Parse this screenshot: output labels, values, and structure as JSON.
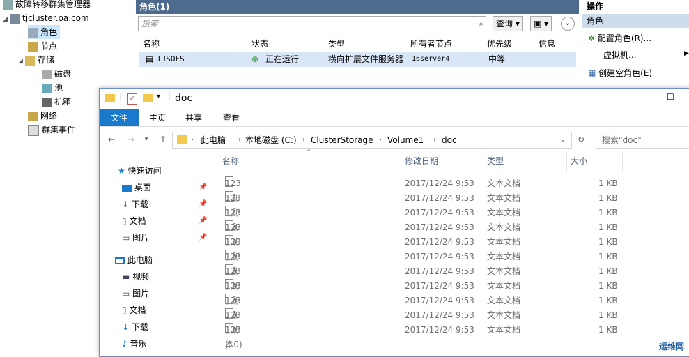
{
  "tree": {
    "app": "故障转移群集管理器",
    "cluster": "tjcluster.oa.com",
    "items": [
      "角色",
      "节点",
      "存储",
      "磁盘",
      "池",
      "机箱",
      "网络",
      "群集事件"
    ]
  },
  "center": {
    "title": "角色(1)",
    "search_placeholder": "搜索",
    "query_btn": "查询",
    "columns": [
      "名称",
      "状态",
      "类型",
      "所有者节点",
      "优先级",
      "信息"
    ],
    "row": {
      "name": "TJSOFS",
      "status": "正在运行",
      "type": "横向扩展文件服务器",
      "owner": "16server4",
      "priority": "中等",
      "info": ""
    }
  },
  "actions": {
    "title": "操作",
    "section": "角色",
    "items": [
      "配置角色(R)...",
      "虚拟机...",
      "创建空角色(E)"
    ]
  },
  "explorer": {
    "title": "doc",
    "tabs": [
      "文件",
      "主页",
      "共享",
      "查看"
    ],
    "path": [
      "此电脑",
      "本地磁盘 (C:)",
      "ClusterStorage",
      "Volume1",
      "doc"
    ],
    "search_placeholder": "搜索\"doc\"",
    "nav": {
      "quick": "快速访问",
      "quick_items": [
        "桌面",
        "下载",
        "文档",
        "图片"
      ],
      "pc": "此电脑",
      "pc_items": [
        "视频",
        "图片",
        "文档",
        "下载",
        "音乐"
      ]
    },
    "columns": [
      "名称",
      "修改日期",
      "类型",
      "大小"
    ],
    "files": [
      {
        "name": "123 - 副本 (2)",
        "date": "2017/12/24 9:53",
        "type": "文本文档",
        "size": "1 KB"
      },
      {
        "name": "123 - 副本 (3)",
        "date": "2017/12/24 9:53",
        "type": "文本文档",
        "size": "1 KB"
      },
      {
        "name": "123 - 副本 (4)",
        "date": "2017/12/24 9:53",
        "type": "文本文档",
        "size": "1 KB"
      },
      {
        "name": "123 - 副本 (5)",
        "date": "2017/12/24 9:53",
        "type": "文本文档",
        "size": "1 KB"
      },
      {
        "name": "123 - 副本 (6)",
        "date": "2017/12/24 9:53",
        "type": "文本文档",
        "size": "1 KB"
      },
      {
        "name": "123 - 副本 (7)",
        "date": "2017/12/24 9:53",
        "type": "文本文档",
        "size": "1 KB"
      },
      {
        "name": "123 - 副本 (8)",
        "date": "2017/12/24 9:53",
        "type": "文本文档",
        "size": "1 KB"
      },
      {
        "name": "123 - 副本 (9)",
        "date": "2017/12/24 9:53",
        "type": "文本文档",
        "size": "1 KB"
      },
      {
        "name": "123 - 副本 (10)",
        "date": "2017/12/24 9:53",
        "type": "文本文档",
        "size": "1 KB"
      },
      {
        "name": "123 - 副本",
        "date": "2017/12/24 9:53",
        "type": "文本文档",
        "size": "1 KB"
      },
      {
        "name": "123",
        "date": "2017/12/24 9:53",
        "type": "文本文档",
        "size": "1 KB"
      }
    ]
  },
  "watermark": "运维网"
}
